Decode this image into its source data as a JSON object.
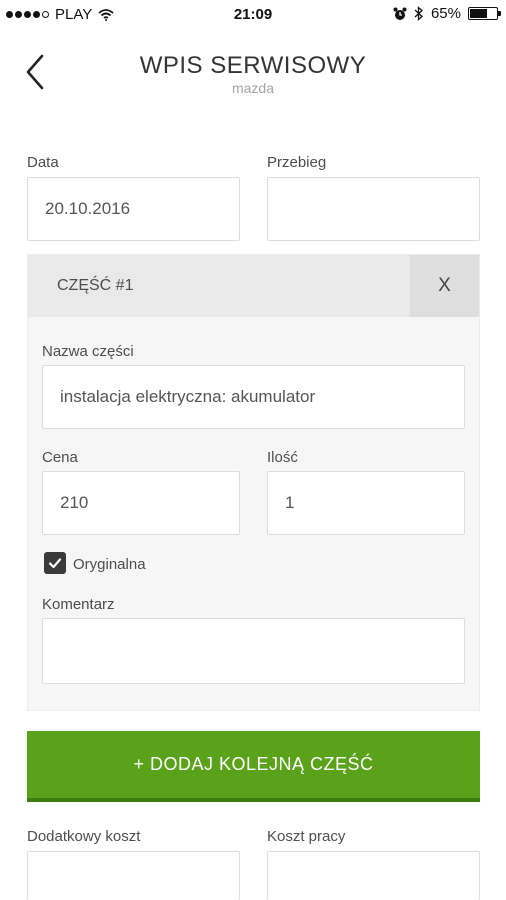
{
  "status": {
    "carrier": "PLAY",
    "time": "21:09",
    "battery": "65%",
    "battery_level": 0.65,
    "signal_bars_filled": 4,
    "signal_bars_total": 5
  },
  "nav": {
    "title": "WPIS SERWISOWY",
    "subtitle": "mazda"
  },
  "form": {
    "date_label": "Data",
    "date_value": "20.10.2016",
    "mileage_label": "Przebieg",
    "mileage_value": "",
    "extra_cost_label": "Dodatkowy koszt",
    "extra_cost_value": "",
    "labor_cost_label": "Koszt pracy",
    "labor_cost_value": ""
  },
  "part": {
    "title": "CZĘŚĆ #1",
    "remove_label": "X",
    "name_label": "Nazwa części",
    "name_value": "instalacja elektryczna: akumulator",
    "price_label": "Cena",
    "price_value": "210",
    "quantity_label": "Ilość",
    "quantity_value": "1",
    "original_label": "Oryginalna",
    "original_checked": true,
    "comment_label": "Komentarz",
    "comment_value": ""
  },
  "add_part_label": "+ DODAJ KOLEJNĄ CZĘŚĆ",
  "colors": {
    "accent": "#5aa219",
    "card_bg": "#f6f6f6",
    "header_bg": "#e9e9e9"
  }
}
